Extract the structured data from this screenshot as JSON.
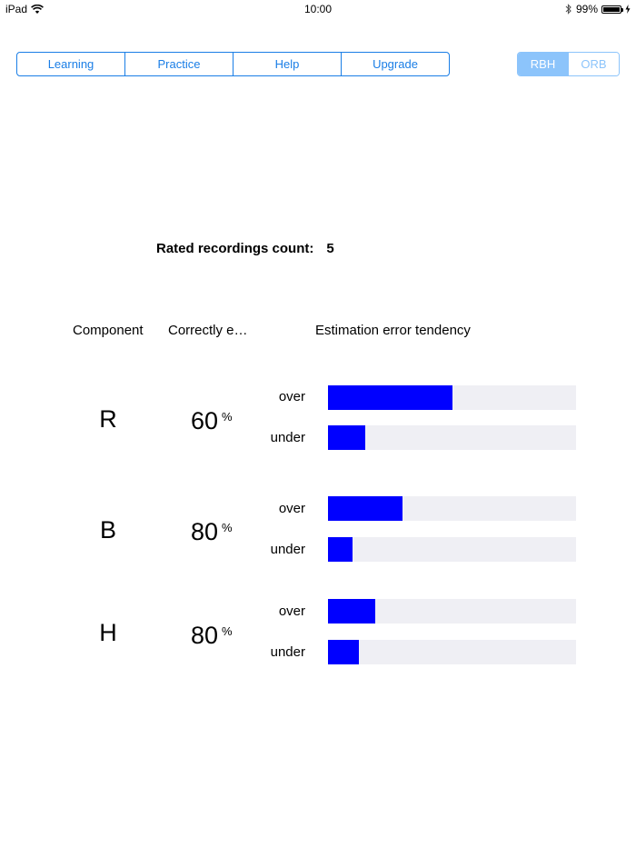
{
  "status_bar": {
    "device": "iPad",
    "time": "10:00",
    "battery": "99%",
    "battery_level": 0.99
  },
  "nav": {
    "items": [
      "Learning",
      "Practice",
      "Help",
      "Upgrade"
    ]
  },
  "mode_toggle": {
    "options": [
      "RBH",
      "ORB"
    ],
    "selected": "RBH"
  },
  "summary": {
    "count_label": "Rated recordings count:",
    "count_value": "5"
  },
  "table": {
    "headers": {
      "component": "Component",
      "correct": "Correctly e…",
      "tendency": "Estimation error tendency"
    },
    "over_label": "over",
    "under_label": "under",
    "percent_sign": "%",
    "rows": [
      {
        "component": "R",
        "correct": "60",
        "over": 0.5,
        "under": 0.15
      },
      {
        "component": "B",
        "correct": "80",
        "over": 0.3,
        "under": 0.1
      },
      {
        "component": "H",
        "correct": "80",
        "over": 0.19,
        "under": 0.125
      }
    ]
  },
  "colors": {
    "accent": "#1a7ee6",
    "bar_fill": "#0000ff",
    "bar_track": "#efeff4"
  }
}
